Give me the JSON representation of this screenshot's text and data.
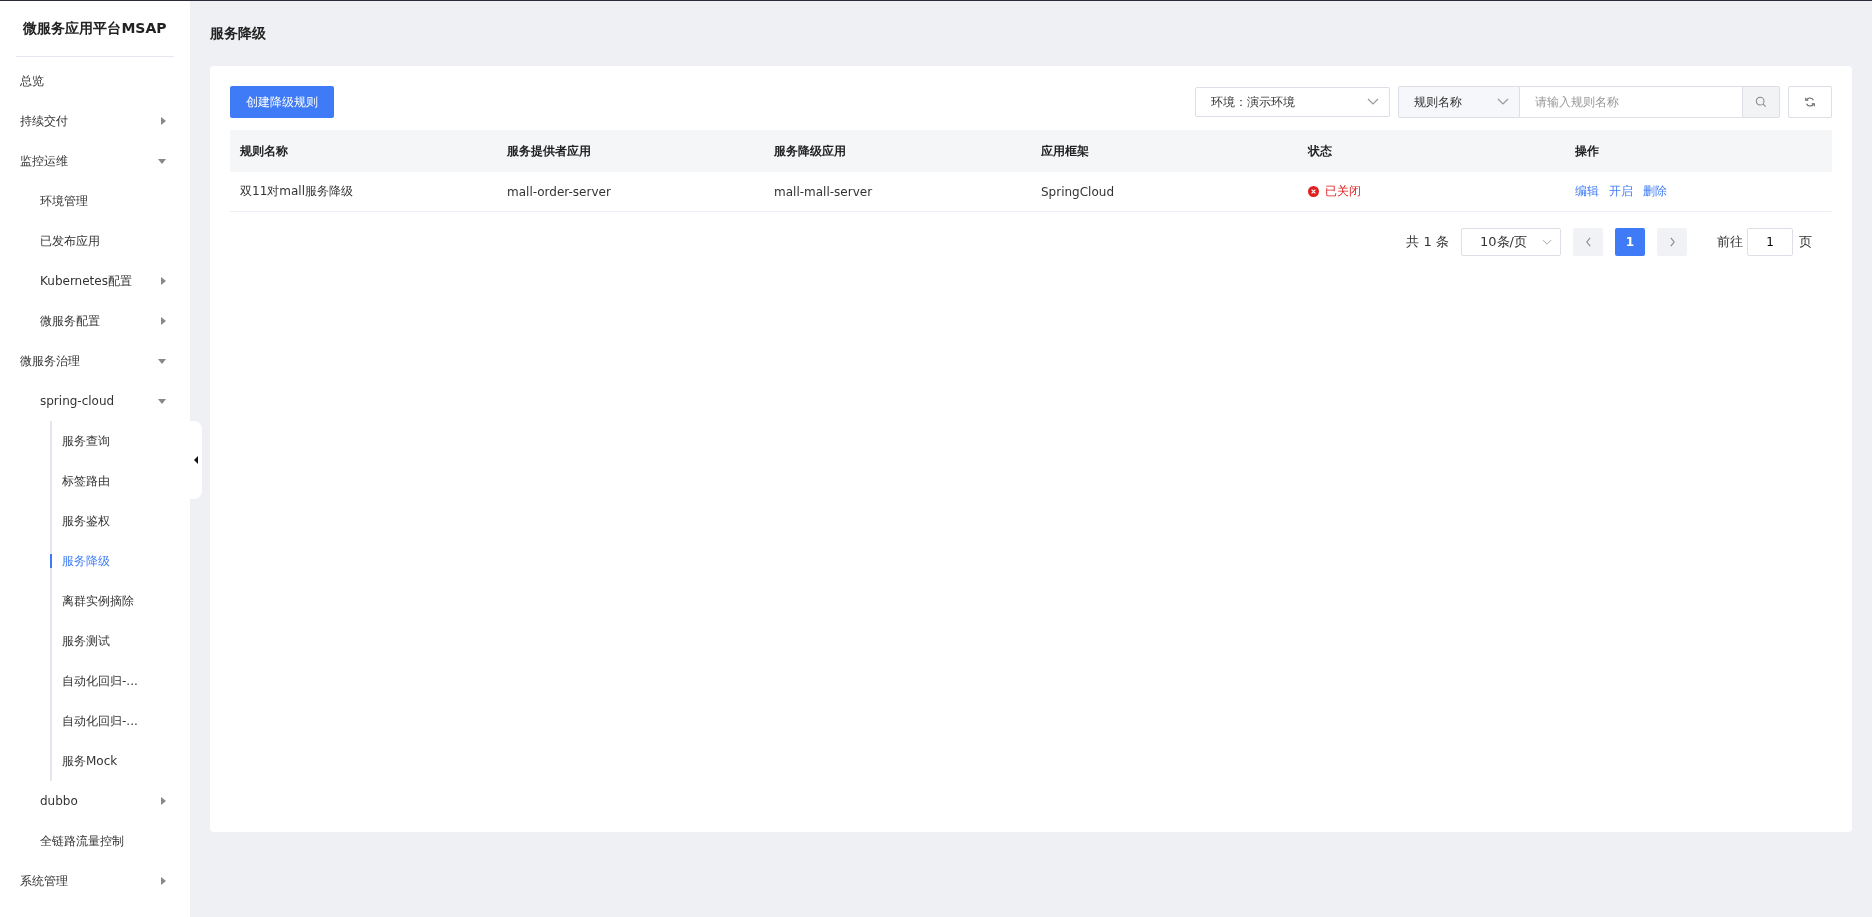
{
  "sidebar": {
    "title": "微服务应用平台MSAP",
    "items": [
      {
        "kind": "link",
        "label": "总览",
        "selected": false
      },
      {
        "kind": "group",
        "label": "持续交付",
        "selected": false,
        "expanded": false
      },
      {
        "kind": "group",
        "label": "监控运维",
        "selected": false,
        "expanded": true,
        "children": [
          {
            "kind": "link",
            "label": "环境管理",
            "selected": false
          },
          {
            "kind": "link",
            "label": "已发布应用",
            "selected": false
          },
          {
            "kind": "group",
            "label": "Kubernetes配置",
            "selected": false,
            "expanded": false
          },
          {
            "kind": "group",
            "label": "微服务配置",
            "selected": false,
            "expanded": false
          }
        ]
      },
      {
        "kind": "group",
        "label": "微服务治理",
        "selected": false,
        "expanded": true,
        "children": [
          {
            "kind": "group",
            "label": "spring-cloud",
            "selected": false,
            "expanded": true,
            "children": [
              {
                "kind": "link",
                "label": "服务查询",
                "selected": false
              },
              {
                "kind": "link",
                "label": "标签路由",
                "selected": false
              },
              {
                "kind": "link",
                "label": "服务鉴权",
                "selected": false
              },
              {
                "kind": "link",
                "label": "服务降级",
                "selected": true
              },
              {
                "kind": "link",
                "label": "离群实例摘除",
                "selected": false
              },
              {
                "kind": "link",
                "label": "服务测试",
                "selected": false
              },
              {
                "kind": "link",
                "label": "自动化回归-...",
                "selected": false
              },
              {
                "kind": "link",
                "label": "自动化回归-...",
                "selected": false
              },
              {
                "kind": "link",
                "label": "服务Mock",
                "selected": false
              }
            ]
          },
          {
            "kind": "group",
            "label": "dubbo",
            "selected": false,
            "expanded": false
          },
          {
            "kind": "link",
            "label": "全链路流量控制",
            "selected": false
          }
        ]
      },
      {
        "kind": "group",
        "label": "系统管理",
        "selected": false,
        "expanded": false
      }
    ]
  },
  "page_title": "服务降级",
  "create_button": "创建降级规则",
  "env_select": {
    "value": "环境：演示环境"
  },
  "search": {
    "field_select": "规则名称",
    "placeholder": "请输入规则名称"
  },
  "table": {
    "columns": [
      "规则名称",
      "服务提供者应用",
      "服务降级应用",
      "应用框架",
      "状态",
      "操作"
    ],
    "rows": [
      {
        "name": "双11对mall服务降级",
        "provider": "mall-order-server",
        "consumer": "mall-mall-server",
        "framework": "SpringCloud",
        "status": {
          "kind": "closed",
          "text": "已关闭"
        },
        "actions": [
          "编辑",
          "开启",
          "删除"
        ]
      }
    ]
  },
  "pagination": {
    "total": "共 1 条",
    "page_size": "10条/页",
    "pages": [
      {
        "label": "1",
        "selected": true
      }
    ],
    "goto_label": "前往",
    "goto_value": "1",
    "goto_suffix": "页"
  }
}
